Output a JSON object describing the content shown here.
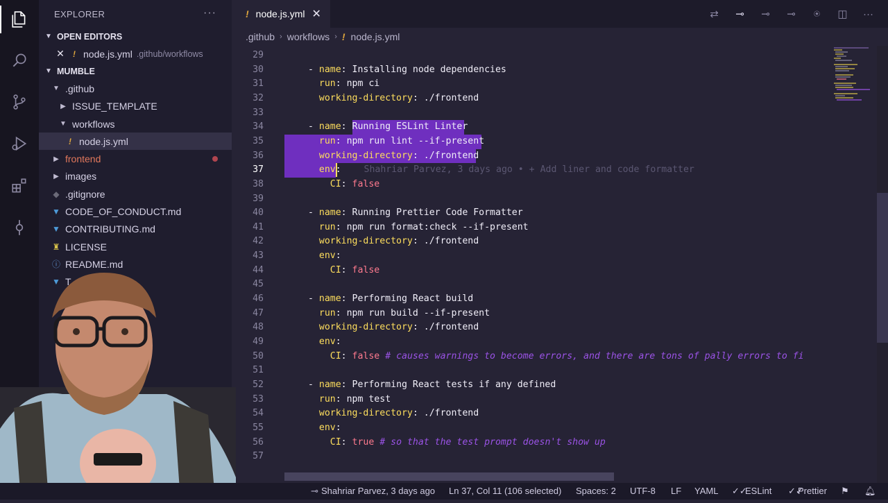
{
  "explorer": {
    "title": "EXPLORER",
    "open_editors_label": "OPEN EDITORS",
    "open_editor": {
      "name": "node.js.yml",
      "path": ".github/workflows"
    },
    "project_label": "MUMBLE",
    "tree": [
      {
        "label": ".github",
        "kind": "folder-open"
      },
      {
        "label": "ISSUE_TEMPLATE",
        "kind": "folder"
      },
      {
        "label": "workflows",
        "kind": "folder-open"
      },
      {
        "label": "node.js.yml",
        "kind": "yaml"
      },
      {
        "label": "frontend",
        "kind": "folder-modified"
      },
      {
        "label": "images",
        "kind": "folder"
      },
      {
        "label": ".gitignore",
        "kind": "gitignore"
      },
      {
        "label": "CODE_OF_CONDUCT.md",
        "kind": "md"
      },
      {
        "label": "CONTRIBUTING.md",
        "kind": "md"
      },
      {
        "label": "LICENSE",
        "kind": "license"
      },
      {
        "label": "README.md",
        "kind": "info"
      },
      {
        "label": "T...DATES.md",
        "kind": "md"
      }
    ]
  },
  "tab": {
    "label": "node.js.yml"
  },
  "breadcrumb": [
    ".github",
    "workflows",
    "node.js.yml"
  ],
  "editor": {
    "blame": "Shahriar Parvez, 3 days ago • + Add liner and code formatter",
    "lines": [
      {
        "n": "29",
        "t": ""
      },
      {
        "n": "30",
        "t": "- name: Installing node dependencies"
      },
      {
        "n": "31",
        "t": "  run: npm ci"
      },
      {
        "n": "32",
        "t": "  working-directory: ./frontend"
      },
      {
        "n": "33",
        "t": ""
      },
      {
        "n": "34",
        "t": "- name: Running ESLint Linter"
      },
      {
        "n": "35",
        "t": "  run: npm run lint --if-present"
      },
      {
        "n": "36",
        "t": "  working-directory: ./frontend"
      },
      {
        "n": "37",
        "t": "  env:"
      },
      {
        "n": "38",
        "t": "    CI: false"
      },
      {
        "n": "39",
        "t": ""
      },
      {
        "n": "40",
        "t": "- name: Running Prettier Code Formatter"
      },
      {
        "n": "41",
        "t": "  run: npm run format:check --if-present"
      },
      {
        "n": "42",
        "t": "  working-directory: ./frontend"
      },
      {
        "n": "43",
        "t": "  env:"
      },
      {
        "n": "44",
        "t": "    CI: false"
      },
      {
        "n": "45",
        "t": ""
      },
      {
        "n": "46",
        "t": "- name: Performing React build"
      },
      {
        "n": "47",
        "t": "  run: npm run build --if-present"
      },
      {
        "n": "48",
        "t": "  working-directory: ./frontend"
      },
      {
        "n": "49",
        "t": "  env:"
      },
      {
        "n": "50",
        "t": "    CI: false # causes warnings to become errors, and there are tons of pally errors to fi"
      },
      {
        "n": "51",
        "t": ""
      },
      {
        "n": "52",
        "t": "- name: Performing React tests if any defined"
      },
      {
        "n": "53",
        "t": "  run: npm test"
      },
      {
        "n": "54",
        "t": "  working-directory: ./frontend"
      },
      {
        "n": "55",
        "t": "  env:"
      },
      {
        "n": "56",
        "t": "    CI: true # so that the test prompt doesn't show up"
      },
      {
        "n": "57",
        "t": ""
      }
    ]
  },
  "statusbar": {
    "blame": "Shahriar Parvez, 3 days ago",
    "position": "Ln 37, Col 11 (106 selected)",
    "spaces": "Spaces: 2",
    "encoding": "UTF-8",
    "eol": "LF",
    "language": "YAML",
    "eslint": "ESLint",
    "prettier": "Prettier"
  },
  "colors": {
    "background": "#262335",
    "selection": "#6f2fbf",
    "key": "#fede5d",
    "boolean": "#fe7a8e",
    "comment": "#9b53e6"
  }
}
